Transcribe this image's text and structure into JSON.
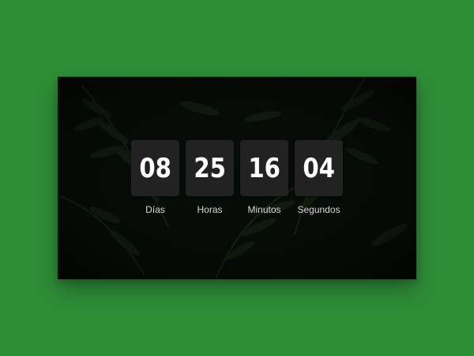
{
  "countdown": {
    "units": [
      {
        "value": "08",
        "label": "Días"
      },
      {
        "value": "25",
        "label": "Horas"
      },
      {
        "value": "16",
        "label": "Minutos"
      },
      {
        "value": "04",
        "label": "Segundos"
      }
    ]
  },
  "colors": {
    "page_background": "#2e8d37",
    "panel_background": "#050705",
    "digit_box": "#222222",
    "digit_text": "#ffffff",
    "label_text": "#d8d8d8"
  }
}
